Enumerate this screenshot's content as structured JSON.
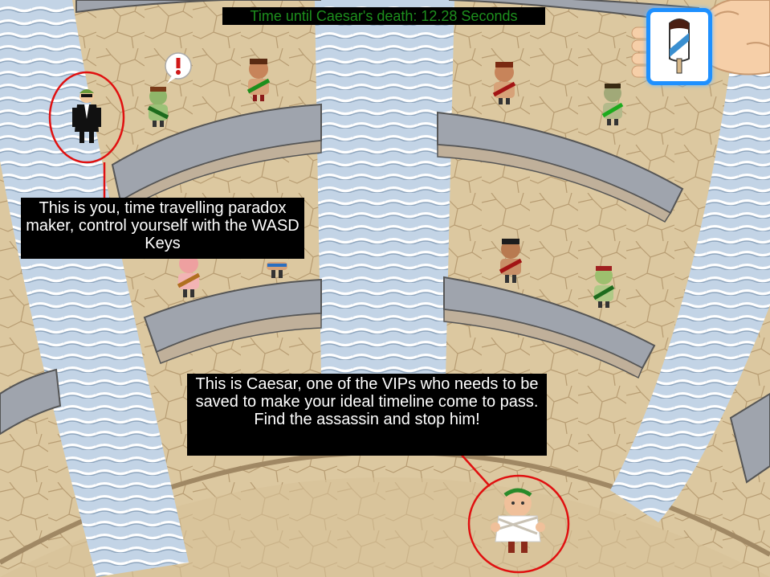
{
  "hud": {
    "timer_text": "Time until Caesar's death: 12.28 Seconds",
    "timer_color": "#1d8f1d"
  },
  "captions": {
    "player": "This is you, time travelling paradox maker, control yourself with the WASD Keys",
    "caesar": "This is Caesar, one of the VIPs who needs to be saved to make your ideal timeline come to pass. Find the assassin and stop him!"
  },
  "inventory": {
    "item_icon": "popsicle-icon",
    "highlight_color": "#1e90ff"
  },
  "alert_icon": "exclamation-bubble-icon",
  "colors": {
    "highlight_ring": "#e01010",
    "sand": "#dcc8a0",
    "stairs": "#b8cde0"
  }
}
